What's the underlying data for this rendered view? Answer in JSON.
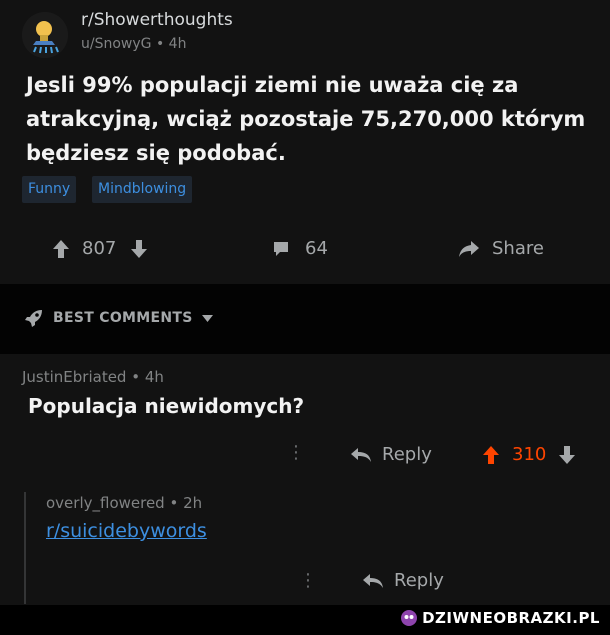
{
  "post": {
    "subreddit": "r/Showerthoughts",
    "author": "u/SnowyG",
    "age": "4h",
    "title": "Jesli 99% populacji ziemi nie uważa cię za atrakcyjną, wciąż pozostaje 75,270,000 którym będziesz się podobać.",
    "flairs": [
      "Funny",
      "Mindblowing"
    ],
    "upvotes": "807",
    "comments": "64",
    "share_label": "Share"
  },
  "sort": {
    "label": "BEST COMMENTS"
  },
  "comment": {
    "author": "JustinEbriated",
    "age": "4h",
    "text": "Populacja niewidomych?",
    "reply_label": "Reply",
    "votes": "310"
  },
  "reply": {
    "author": "overly_flowered",
    "age": "2h",
    "link": "r/suicidebywords",
    "reply_label": "Reply"
  },
  "watermark": {
    "text": "DZIWNEOBRAZKI.PL"
  },
  "colors": {
    "upvote_active": "#ff4500",
    "link": "#3d8fe0",
    "background": "#121212"
  }
}
